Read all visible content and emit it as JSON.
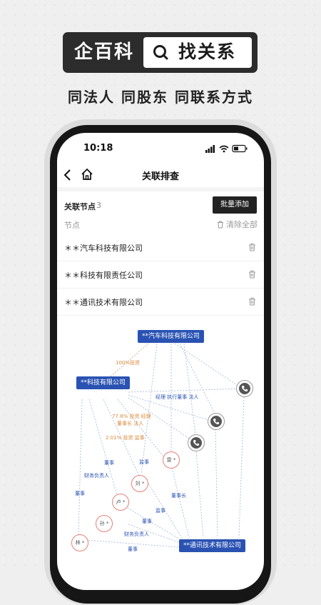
{
  "promo": {
    "brand": "企百科",
    "search_text": "找关系",
    "tagline": "同法人 同股东 同联系方式"
  },
  "status_bar": {
    "time": "10:18"
  },
  "nav": {
    "title": "关联排查"
  },
  "panel": {
    "section_title": "关联节点",
    "count": "3",
    "batch_add": "批量添加",
    "node_label": "节点",
    "clear_all": "清除全部",
    "nodes": [
      "＊＊汽车科技有限公司",
      "＊＊科技有限责任公司",
      "＊＊通讯技术有限公司"
    ]
  },
  "graph": {
    "companies": {
      "auto": "**汽车科技有限公司",
      "tech": "**科技有限公司",
      "comm": "**通讯技术有限公司"
    },
    "persons": {
      "lei": "雷 *",
      "liu": "刘 *",
      "lu": "卢 *",
      "sun": "孙 *",
      "lin": "林 *"
    },
    "edges": {
      "invest100": "100%投资",
      "manager": "经理 执行董事 法人",
      "invest77a": "77.8% 投资 经理",
      "invest77b": "董事长 法人",
      "invest2": "2.01% 投资 监事",
      "dongshi1": "董事",
      "jianshi": "监事",
      "lei_role": "雷 *",
      "caiwu1": "财务负责人",
      "dongshizhang": "董事长",
      "dongshi2": "董事",
      "jianshi2": "监事",
      "dongshi3": "董事",
      "caiwu2": "财务负责人",
      "dongshi4": "董事"
    },
    "colors": {
      "company": "#2952b3",
      "person_border": "#e5807a",
      "invest": "#d98a3b"
    }
  }
}
